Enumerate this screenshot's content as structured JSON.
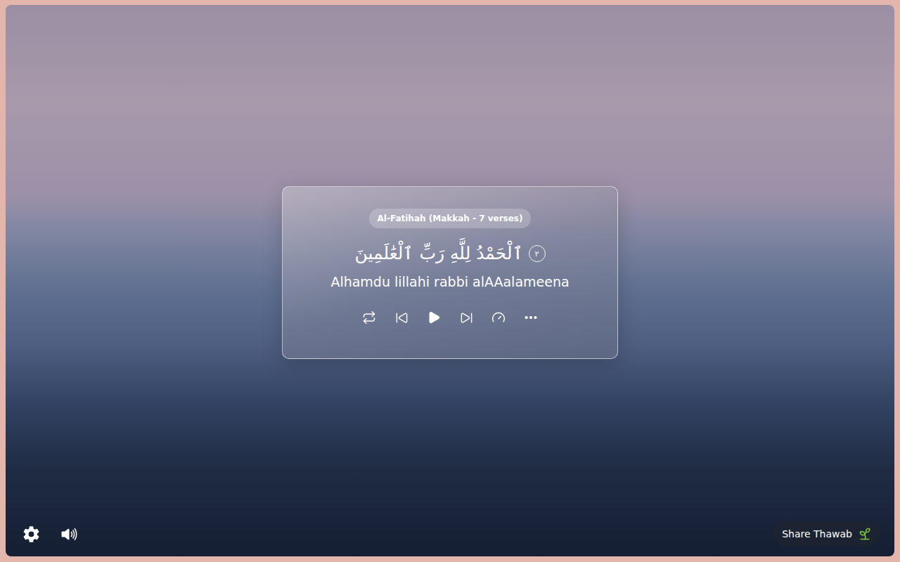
{
  "player": {
    "surah_badge": "Al-Fatihah (Makkah - 7 verses)",
    "verse": {
      "arabic": "ٱلْحَمْدُ لِلَّهِ رَبِّ ٱلْعَٰلَمِينَ",
      "number": "٢",
      "transliteration": "Alhamdu lillahi rabbi alAAalameena"
    },
    "playing": false
  },
  "share_button": {
    "label": "Share Thawab"
  }
}
